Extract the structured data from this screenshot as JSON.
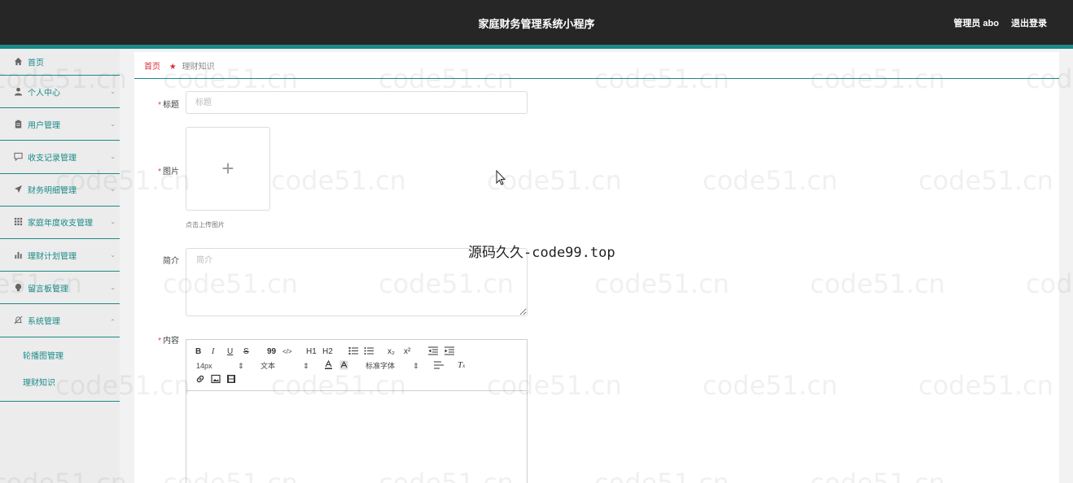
{
  "header": {
    "title": "家庭财务管理系统小程序",
    "admin": "管理员 abo",
    "logout": "退出登录"
  },
  "sidebar": {
    "items": [
      {
        "label": "首页",
        "icon": "home-icon"
      },
      {
        "label": "个人中心",
        "icon": "user-icon"
      },
      {
        "label": "用户管理",
        "icon": "clipboard-icon"
      },
      {
        "label": "收支记录管理",
        "icon": "chat-icon"
      },
      {
        "label": "财务明细管理",
        "icon": "send-icon"
      },
      {
        "label": "家庭年度收支管理",
        "icon": "grid-icon"
      },
      {
        "label": "理财计划管理",
        "icon": "bar-chart-icon"
      },
      {
        "label": "留言板管理",
        "icon": "bulb-icon"
      },
      {
        "label": "系统管理",
        "icon": "bell-off-icon"
      }
    ],
    "submenu": [
      {
        "label": "轮播图管理"
      },
      {
        "label": "理财知识"
      }
    ]
  },
  "breadcrumb": {
    "home": "首页",
    "current": "理财知识"
  },
  "form": {
    "title_label": "标题",
    "title_placeholder": "标题",
    "image_label": "图片",
    "upload_tip": "点击上传图片",
    "intro_label": "简介",
    "intro_placeholder": "简介",
    "content_label": "内容",
    "required_mark": "*"
  },
  "editor": {
    "bold": "B",
    "italic": "I",
    "underline": "U",
    "strike": "S",
    "quote": "99",
    "code": "</>",
    "h1": "H1",
    "h2": "H2",
    "sub": "x₂",
    "sup": "x²",
    "size": "14px",
    "header_select": "文本",
    "font_select": "标准字体"
  },
  "watermark": "code51.cn",
  "overlay_text": "源码久久-code99.top"
}
